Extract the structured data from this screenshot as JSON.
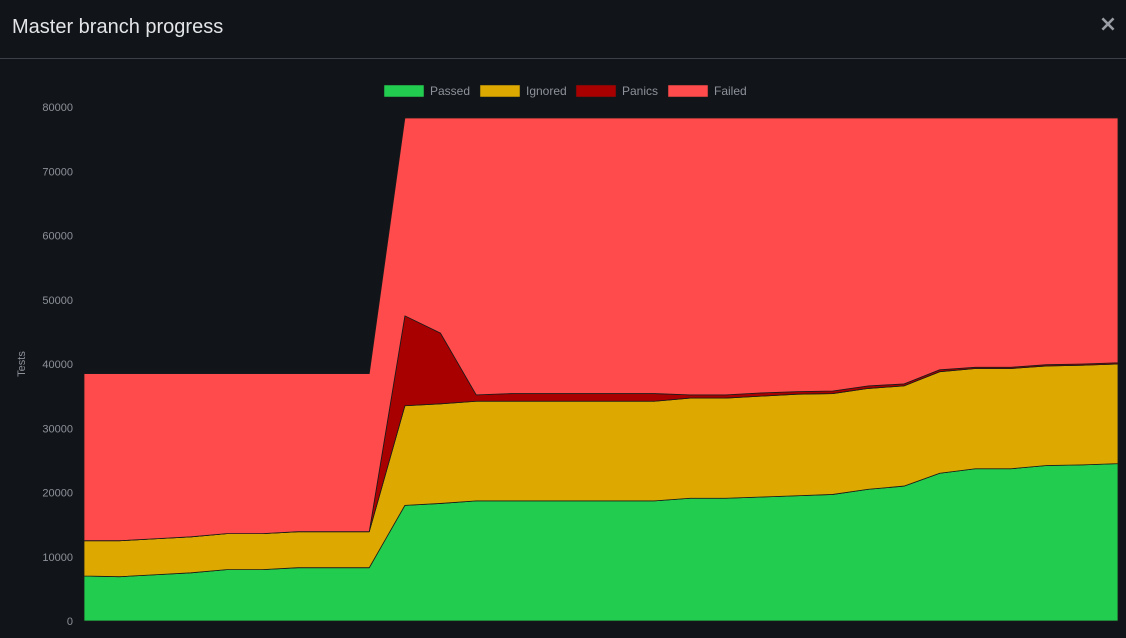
{
  "modal": {
    "title": "Master branch progress",
    "close_label": "×"
  },
  "chart_data": {
    "type": "area",
    "stacked": true,
    "ylabel": "Tests",
    "xlabel": "",
    "ylim": [
      0,
      80000
    ],
    "yticks": [
      0,
      10000,
      20000,
      30000,
      40000,
      50000,
      60000,
      70000,
      80000
    ],
    "grid": false,
    "legend_position": "top-center",
    "x": [
      0,
      1,
      2,
      3,
      4,
      5,
      6,
      7,
      8,
      9,
      10,
      11,
      12,
      13,
      14,
      15,
      16,
      17,
      18,
      19,
      20,
      21,
      22,
      23,
      24,
      25,
      26,
      27,
      28,
      29
    ],
    "series": [
      {
        "name": "Passed",
        "color": "#22cc4f",
        "values": [
          7000,
          6900,
          7200,
          7500,
          8000,
          8000,
          8300,
          8300,
          8300,
          18000,
          18300,
          18700,
          18700,
          18700,
          18700,
          18700,
          18700,
          19100,
          19100,
          19300,
          19500,
          19700,
          20500,
          21000,
          23000,
          23700,
          23700,
          24200,
          24300,
          24500
        ]
      },
      {
        "name": "Ignored",
        "color": "#dda800",
        "values": [
          5500,
          5600,
          5600,
          5600,
          5600,
          5600,
          5600,
          5600,
          5600,
          15500,
          15500,
          15500,
          15500,
          15500,
          15500,
          15500,
          15500,
          15600,
          15600,
          15700,
          15800,
          15700,
          15700,
          15600,
          15800,
          15600,
          15600,
          15500,
          15500,
          15500
        ]
      },
      {
        "name": "Panics",
        "color": "#a80000",
        "values": [
          0,
          0,
          0,
          0,
          0,
          0,
          0,
          0,
          0,
          14000,
          11000,
          1000,
          1200,
          1200,
          1200,
          1200,
          1200,
          500,
          500,
          500,
          400,
          400,
          400,
          300,
          300,
          200,
          200,
          200,
          200,
          200
        ]
      },
      {
        "name": "Failed",
        "color": "#ff4b4b",
        "values": [
          26000,
          26000,
          25700,
          25400,
          24900,
          24900,
          24600,
          24600,
          24600,
          30800,
          33500,
          43100,
          42900,
          42900,
          42900,
          42900,
          42900,
          43100,
          43100,
          42800,
          42600,
          42500,
          41700,
          41400,
          39200,
          38800,
          38800,
          38400,
          38300,
          38100
        ]
      }
    ]
  }
}
